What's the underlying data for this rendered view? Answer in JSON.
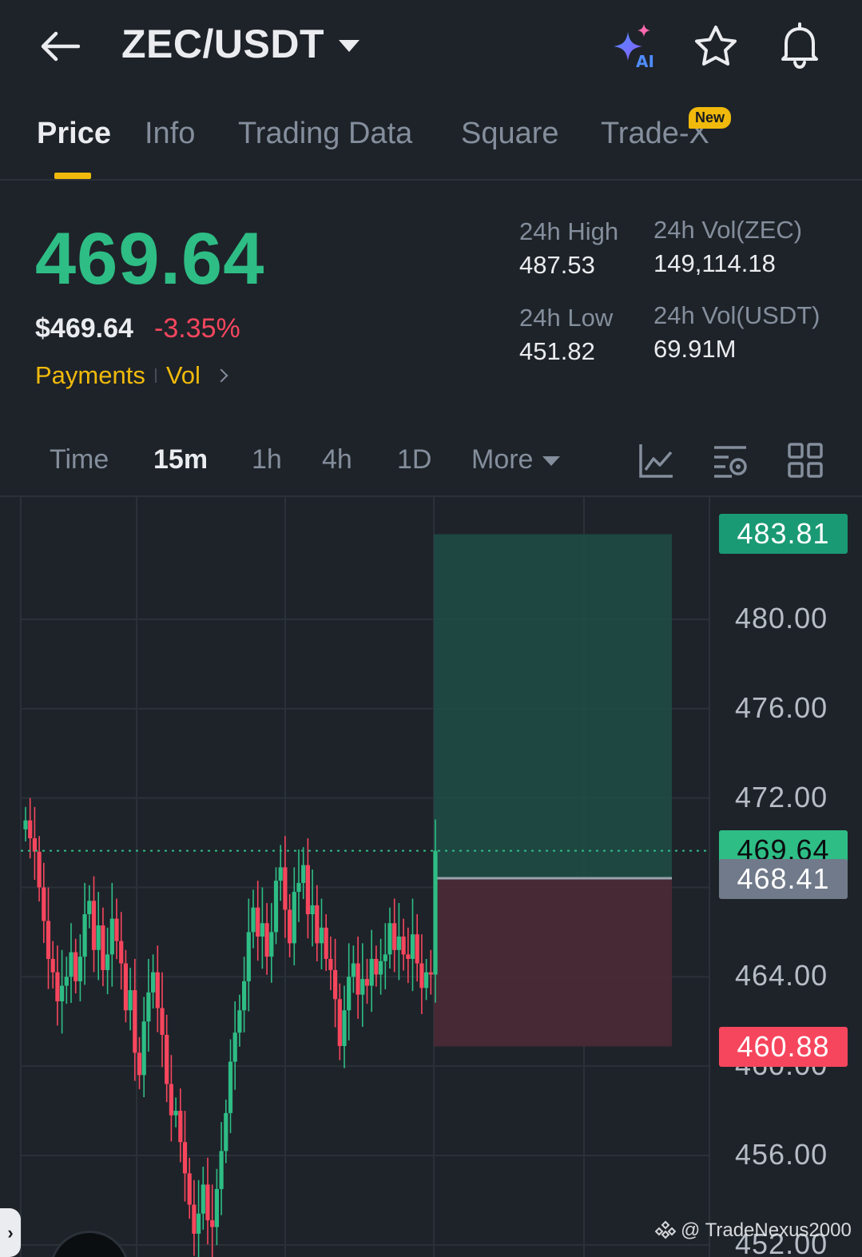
{
  "header": {
    "pair": "ZEC/USDT",
    "icons": [
      "back-arrow-icon",
      "ai-sparkle-icon",
      "star-icon",
      "bell-icon"
    ],
    "ai_label": "AI"
  },
  "tabs": [
    {
      "label": "Price",
      "active": true
    },
    {
      "label": "Info",
      "active": false
    },
    {
      "label": "Trading Data",
      "active": false
    },
    {
      "label": "Square",
      "active": false
    },
    {
      "label": "Trade-X",
      "active": false
    }
  ],
  "new_badge": "New",
  "ticker": {
    "last_price": "469.64",
    "usd_price": "$469.64",
    "change_pct": "-3.35%",
    "tags": [
      "Payments",
      "Vol"
    ],
    "high_label": "24h High",
    "high_value": "487.53",
    "low_label": "24h Low",
    "low_value": "451.82",
    "vol_base_label": "24h Vol(ZEC)",
    "vol_base_value": "149,114.18",
    "vol_quote_label": "24h Vol(USDT)",
    "vol_quote_value": "69.91M"
  },
  "intervals": [
    {
      "label": "Time",
      "active": false
    },
    {
      "label": "15m",
      "active": true
    },
    {
      "label": "1h",
      "active": false
    },
    {
      "label": "4h",
      "active": false
    },
    {
      "label": "1D",
      "active": false
    },
    {
      "label": "More",
      "active": false
    }
  ],
  "toolbar_icons": [
    "indicator-chart-icon",
    "chart-settings-icon",
    "layout-grid-icon"
  ],
  "chart": {
    "axis_labels": [
      "480.00",
      "476.00",
      "472.00",
      "468.00",
      "464.00",
      "460.00",
      "456.00",
      "452.00"
    ],
    "take_profit": "483.81",
    "current": "469.64",
    "entry": "468.41",
    "stop_loss": "460.88",
    "colors": {
      "up": "#2ebd85",
      "down": "#f6465d",
      "tp_zone": "#1f4d45",
      "sl_zone": "#4a2a35"
    },
    "candle_closes": [
      471.0,
      470.2,
      469.6,
      468.0,
      466.5,
      464.8,
      464.2,
      462.9,
      463.6,
      464.0,
      465.1,
      463.8,
      464.9,
      466.8,
      467.4,
      465.2,
      466.3,
      464.3,
      465.0,
      466.6,
      465.6,
      464.6,
      462.5,
      463.4,
      460.6,
      459.6,
      462.0,
      463.3,
      464.2,
      462.6,
      461.4,
      459.2,
      457.8,
      458.0,
      456.6,
      455.2,
      453.8,
      452.5,
      453.4,
      454.7,
      453.1,
      452.8,
      454.5,
      456.2,
      457.9,
      460.2,
      461.5,
      462.5,
      463.8,
      466.0,
      467.1,
      465.8,
      466.4,
      464.9,
      466.0,
      468.3,
      468.9,
      467.0,
      465.5,
      467.8,
      468.2,
      469.0,
      466.8,
      467.2,
      465.5,
      466.2,
      464.8,
      464.3,
      463.0,
      460.9,
      462.5,
      464.0,
      464.6,
      463.2,
      463.9,
      463.6,
      464.8,
      464.1,
      464.7,
      465.0,
      466.4,
      465.2,
      465.8,
      465.0,
      464.8,
      465.9,
      464.6,
      463.5,
      464.2,
      464.1,
      469.64
    ]
  },
  "watermark": "@ TradeNexus2000"
}
